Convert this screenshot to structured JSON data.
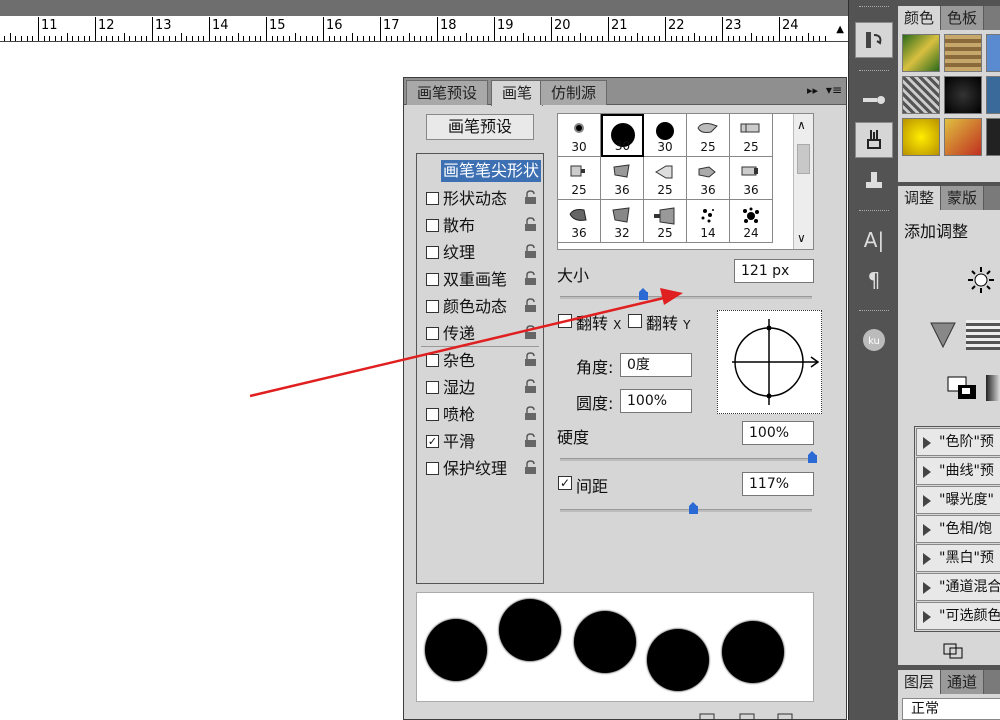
{
  "ruler": {
    "labels": [
      "11",
      "12",
      "13",
      "14",
      "15",
      "16",
      "17",
      "18",
      "19",
      "20",
      "21",
      "22",
      "23",
      "24"
    ],
    "scroll_up": "▲"
  },
  "brush_panel": {
    "tabs": [
      "画笔预设",
      "画笔",
      "仿制源"
    ],
    "active_tab": "画笔",
    "collapse_icon": "▸▸",
    "menu_icon": "▾≡",
    "preset_button": "画笔预设",
    "options": [
      {
        "label": "画笔笔尖形状",
        "header": true
      },
      {
        "label": "形状动态",
        "checked": false
      },
      {
        "label": "散布",
        "checked": false
      },
      {
        "label": "纹理",
        "checked": false
      },
      {
        "label": "双重画笔",
        "checked": false
      },
      {
        "label": "颜色动态",
        "checked": false
      },
      {
        "label": "传递",
        "checked": false
      },
      {
        "label": "杂色",
        "checked": false
      },
      {
        "label": "湿边",
        "checked": false
      },
      {
        "label": "喷枪",
        "checked": false
      },
      {
        "label": "平滑",
        "checked": true
      },
      {
        "label": "保护纹理",
        "checked": false
      }
    ],
    "tips": [
      {
        "size": "30",
        "kind": "soft"
      },
      {
        "size": "30",
        "kind": "hard-large",
        "selected": true
      },
      {
        "size": "30",
        "kind": "hard"
      },
      {
        "size": "25",
        "kind": "brush-a"
      },
      {
        "size": "25",
        "kind": "brush-b"
      },
      {
        "size": "25",
        "kind": "brush-c"
      },
      {
        "size": "36",
        "kind": "brush-d"
      },
      {
        "size": "25",
        "kind": "brush-e"
      },
      {
        "size": "36",
        "kind": "brush-f"
      },
      {
        "size": "36",
        "kind": "brush-g"
      },
      {
        "size": "36",
        "kind": "brush-h"
      },
      {
        "size": "32",
        "kind": "brush-i"
      },
      {
        "size": "25",
        "kind": "brush-j"
      },
      {
        "size": "14",
        "kind": "scatter-a"
      },
      {
        "size": "24",
        "kind": "scatter-b"
      }
    ],
    "size_label": "大小",
    "size_value": "121 px",
    "size_fraction": 0.33,
    "flip_x_label": "翻转",
    "flip_x_axis": "X",
    "flip_y_label": "翻转",
    "flip_y_axis": "Y",
    "angle_label": "角度:",
    "angle_value": "0度",
    "roundness_label": "圆度:",
    "roundness_value": "100%",
    "hardness_label": "硬度",
    "hardness_value": "100%",
    "hardness_fraction": 1.0,
    "spacing_label": "间距",
    "spacing_checked": true,
    "spacing_value": "117%",
    "spacing_fraction": 0.53
  },
  "right_panels": {
    "color_tabs": [
      "颜色",
      "色板"
    ],
    "adjust_tabs": [
      "调整",
      "蒙版"
    ],
    "add_adjustment": "添加调整",
    "presets": [
      "\"色阶\"预",
      "\"曲线\"预",
      "\"曝光度\"",
      "\"色相/饱",
      "\"黑白\"预",
      "\"通道混合",
      "\"可选颜色"
    ],
    "layers_tabs": [
      "图层",
      "通道"
    ],
    "blend_mode": "正常"
  },
  "colors": {
    "accent_blue": "#2b6ad4",
    "arrow_red": "#e02020",
    "panel_gray": "#d6d6d6",
    "dock_dark": "#535353"
  }
}
